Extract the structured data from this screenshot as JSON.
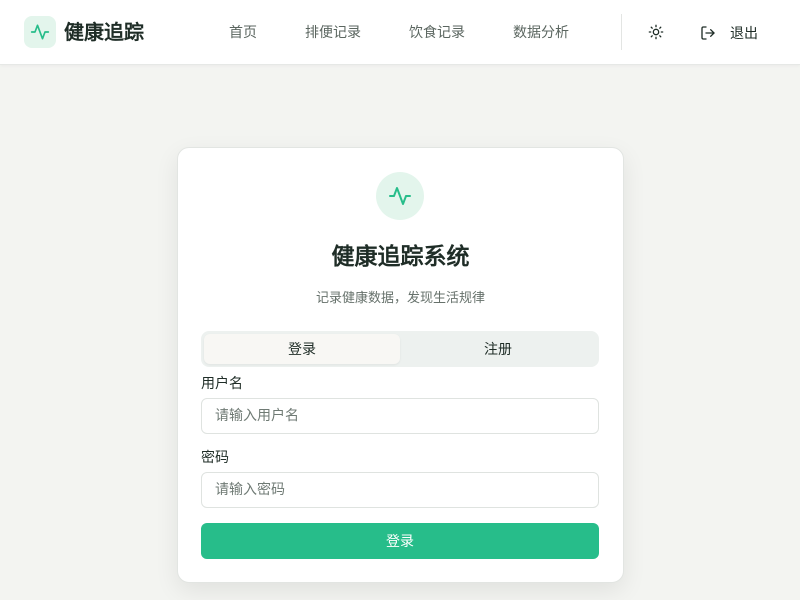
{
  "colors": {
    "accent": "#27bd8a",
    "accent_soft": "#e3f5ec",
    "text_primary": "#1f2d27",
    "text_muted": "#66716b",
    "background": "#f3f4f1"
  },
  "header": {
    "logo_icon": "activity-icon",
    "brand": "健康追踪",
    "nav": [
      {
        "label": "首页"
      },
      {
        "label": "排便记录"
      },
      {
        "label": "饮食记录"
      },
      {
        "label": "数据分析"
      }
    ],
    "theme_icon": "sun-icon",
    "logout_icon": "logout-icon",
    "logout_label": "退出"
  },
  "card": {
    "icon": "activity-icon",
    "title": "健康追踪系统",
    "subtitle": "记录健康数据，发现生活规律",
    "tabs": [
      {
        "label": "登录",
        "active": true
      },
      {
        "label": "注册",
        "active": false
      }
    ],
    "username": {
      "label": "用户名",
      "placeholder": "请输入用户名",
      "value": ""
    },
    "password": {
      "label": "密码",
      "placeholder": "请输入密码",
      "value": ""
    },
    "submit_label": "登录"
  }
}
